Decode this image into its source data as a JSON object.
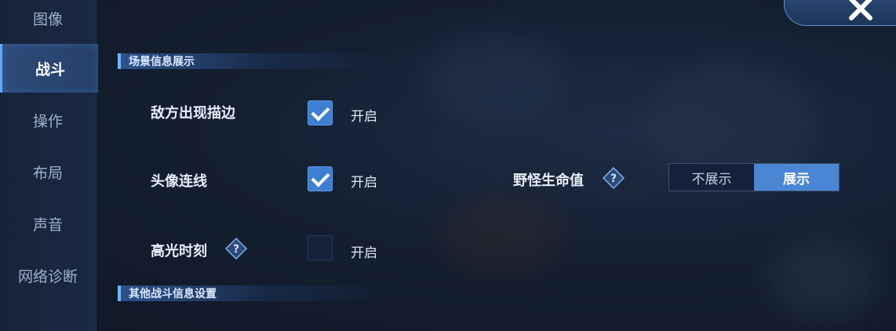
{
  "sidebar": {
    "items": [
      {
        "label": "图像",
        "active": false
      },
      {
        "label": "战斗",
        "active": true
      },
      {
        "label": "操作",
        "active": false
      },
      {
        "label": "布局",
        "active": false
      },
      {
        "label": "声音",
        "active": false
      },
      {
        "label": "网络诊断",
        "active": false
      }
    ]
  },
  "sections": {
    "scene_info": "场景信息展示",
    "other_battle": "其他战斗信息设置"
  },
  "settings": {
    "enemy_outline": {
      "label": "敌方出现描边",
      "state": "开启",
      "checked": true
    },
    "avatar_link": {
      "label": "头像连线",
      "state": "开启",
      "checked": true
    },
    "highlight": {
      "label": "高光时刻",
      "state": "开启",
      "checked": false
    },
    "monster_hp": {
      "label": "野怪生命值",
      "options": [
        "不展示",
        "展示"
      ],
      "selected": "展示"
    }
  },
  "icons": {
    "help": "help-diamond-icon",
    "close": "close-icon",
    "check": "checkmark-icon"
  },
  "colors": {
    "accent": "#4a86d4",
    "active_tab": "#2d4a78",
    "background": "#141f31"
  }
}
